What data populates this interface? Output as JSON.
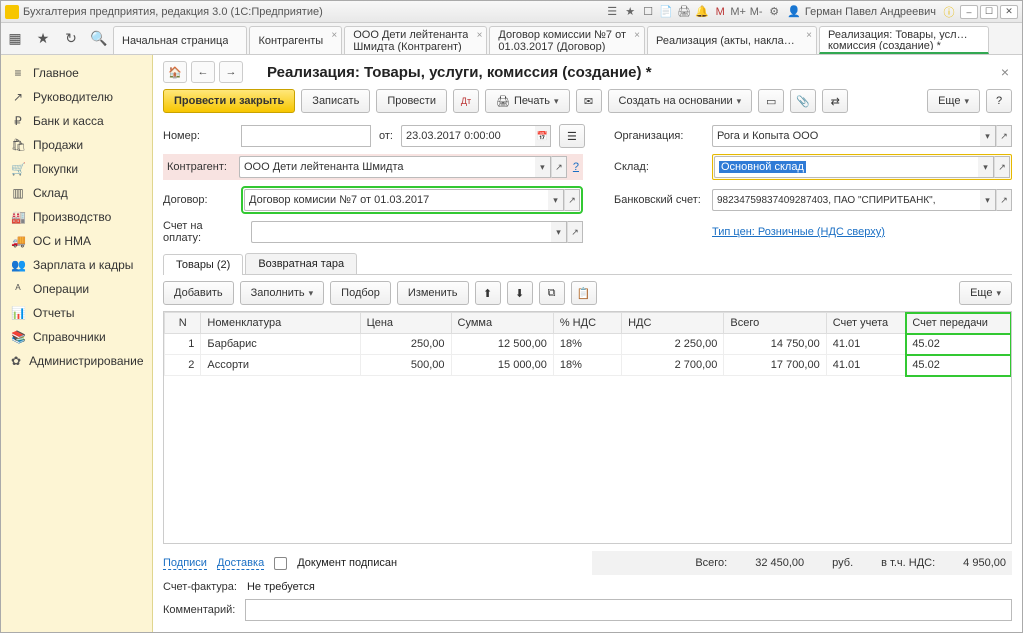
{
  "app": {
    "title": "Бухгалтерия предприятия, редакция 3.0   (1С:Предприятие)",
    "user": "Герман Павел Андреевич"
  },
  "maintabs": [
    {
      "l1": "Начальная страница"
    },
    {
      "l1": "Контрагенты"
    },
    {
      "l1": "ООО Дети лейтенанта",
      "l2": "Шмидта (Контрагент)"
    },
    {
      "l1": "Договор комиссии №7 от",
      "l2": "01.03.2017 (Договор)"
    },
    {
      "l1": "Реализация (акты, накладные)"
    },
    {
      "l1": "Реализация: Товары, услуги,",
      "l2": "комиссия (создание) *"
    }
  ],
  "sidebar": {
    "items": [
      {
        "icon": "≡",
        "label": "Главное"
      },
      {
        "icon": "↗",
        "label": "Руководителю"
      },
      {
        "icon": "₽",
        "label": "Банк и касса"
      },
      {
        "icon": "🛍",
        "label": "Продажи"
      },
      {
        "icon": "🛒",
        "label": "Покупки"
      },
      {
        "icon": "▥",
        "label": "Склад"
      },
      {
        "icon": "🏭",
        "label": "Производство"
      },
      {
        "icon": "🚚",
        "label": "ОС и НМА"
      },
      {
        "icon": "👥",
        "label": "Зарплата и кадры"
      },
      {
        "icon": "ᴬ",
        "label": "Операции"
      },
      {
        "icon": "📊",
        "label": "Отчеты"
      },
      {
        "icon": "📚",
        "label": "Справочники"
      },
      {
        "icon": "✿",
        "label": "Администрирование"
      }
    ]
  },
  "page": {
    "title": "Реализация: Товары, услуги, комиссия (создание) *"
  },
  "toolbar": {
    "post_close": "Провести и закрыть",
    "record": "Записать",
    "post": "Провести",
    "print": "Печать",
    "create_based": "Создать на основании",
    "more": "Еще"
  },
  "fields": {
    "number_label": "Номер:",
    "from_label": "от:",
    "date_value": "23.03.2017  0:00:00",
    "org_label": "Организация:",
    "org_value": "Рога и Копыта ООО",
    "contragent_label": "Контрагент:",
    "contragent_value": "ООО Дети лейтенанта Шмидта",
    "warehouse_label": "Склад:",
    "warehouse_value": "Основной склад",
    "contract_label": "Договор:",
    "contract_value": "Договор комисии №7 от 01.03.2017",
    "bank_label": "Банковский счет:",
    "bank_value": "98234759837409287403, ПАО \"СПИРИТБАНК\",",
    "payacc_label": "Счет на оплату:",
    "pricetype_label": "Тип цен: Розничные (НДС сверху)"
  },
  "tabs2": {
    "goods": "Товары (2)",
    "tare": "Возвратная тара"
  },
  "subbar": {
    "add": "Добавить",
    "fill": "Заполнить",
    "pick": "Подбор",
    "edit": "Изменить",
    "more": "Еще"
  },
  "table": {
    "headers": {
      "n": "N",
      "nom": "Номенклатура",
      "price": "Цена",
      "sum": "Сумма",
      "vatp": "% НДС",
      "vat": "НДС",
      "total": "Всего",
      "acc": "Счет учета",
      "acct": "Счет передачи"
    },
    "rows": [
      {
        "n": "1",
        "nom": "Барбарис",
        "price": "250,00",
        "sum": "12 500,00",
        "vatp": "18%",
        "vat": "2 250,00",
        "total": "14 750,00",
        "acc": "41.01",
        "acct": "45.02"
      },
      {
        "n": "2",
        "nom": "Ассорти",
        "price": "500,00",
        "sum": "15 000,00",
        "vatp": "18%",
        "vat": "2 700,00",
        "total": "17 700,00",
        "acc": "41.01",
        "acct": "45.02"
      }
    ]
  },
  "footer": {
    "sign": "Подписи",
    "delivery": "Доставка",
    "doc_signed": "Документ подписан",
    "total_label": "Всего:",
    "total": "32 450,00",
    "cur": "руб.",
    "vat_label": "в т.ч. НДС:",
    "vat": "4 950,00",
    "invoice_label": "Счет-фактура:",
    "invoice_value": "Не требуется",
    "comment_label": "Комментарий:"
  }
}
